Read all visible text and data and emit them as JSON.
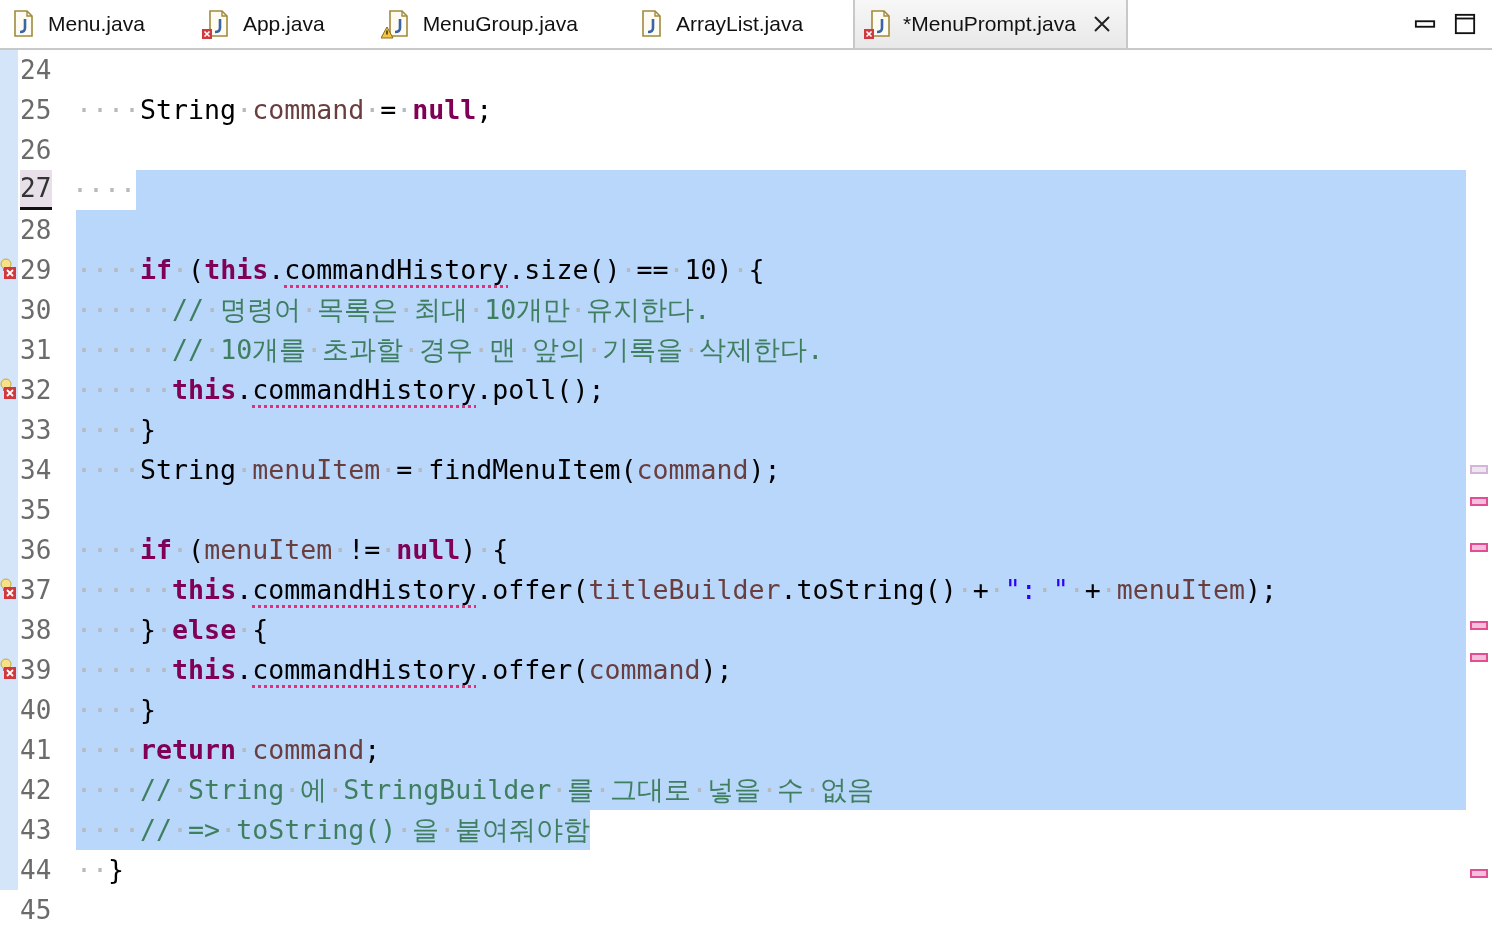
{
  "tabs": [
    {
      "label": "Menu.java",
      "error": false,
      "warning": false,
      "selected": false
    },
    {
      "label": "App.java",
      "error": true,
      "warning": false,
      "selected": false
    },
    {
      "label": "MenuGroup.java",
      "error": false,
      "warning": true,
      "selected": false
    },
    {
      "label": "ArrayList.java",
      "error": false,
      "warning": false,
      "selected": false
    },
    {
      "label": "*MenuPrompt.java",
      "error": true,
      "warning": false,
      "selected": true
    }
  ],
  "editor": {
    "lines": [
      {
        "number": "24",
        "current": false,
        "error": false,
        "selected": false
      },
      {
        "number": "25",
        "current": false,
        "error": false,
        "selected": false,
        "tokens": [
          {
            "kind": "ws",
            "text": "····"
          },
          {
            "kind": "plain",
            "text": "String"
          },
          {
            "kind": "ws",
            "text": "·"
          },
          {
            "kind": "local",
            "text": "command"
          },
          {
            "kind": "plain",
            "text": "·=·"
          },
          {
            "kind": "keyword",
            "text": "null"
          },
          {
            "kind": "plain",
            "text": ";"
          }
        ]
      },
      {
        "number": "26",
        "current": false,
        "error": false,
        "selected": false
      },
      {
        "number": "27",
        "current": true,
        "error": false,
        "selected": true,
        "tokens": [
          {
            "kind": "ws",
            "text": "····"
          }
        ]
      },
      {
        "number": "28",
        "current": false,
        "error": false,
        "selected": true
      },
      {
        "number": "29",
        "current": false,
        "error": true,
        "selected": true,
        "tokens": [
          {
            "kind": "ws",
            "text": "····"
          },
          {
            "kind": "keyword",
            "text": "if"
          },
          {
            "kind": "plain",
            "text": "·("
          },
          {
            "kind": "keyword",
            "text": "this"
          },
          {
            "kind": "plain",
            "text": "."
          },
          {
            "kind": "error",
            "text": "commandHistory"
          },
          {
            "kind": "plain",
            "text": ".size()·==·10)·{"
          }
        ]
      },
      {
        "number": "30",
        "current": false,
        "error": false,
        "selected": true,
        "tokens": [
          {
            "kind": "ws",
            "text": "······"
          },
          {
            "kind": "comment",
            "text": "//·명령어·목록은·최대·10개만·유지한다."
          }
        ]
      },
      {
        "number": "31",
        "current": false,
        "error": false,
        "selected": true,
        "tokens": [
          {
            "kind": "ws",
            "text": "······"
          },
          {
            "kind": "comment",
            "text": "//·10개를·초과할·경우·맨·앞의·기록을·삭제한다."
          }
        ]
      },
      {
        "number": "32",
        "current": false,
        "error": true,
        "selected": true,
        "tokens": [
          {
            "kind": "ws",
            "text": "······"
          },
          {
            "kind": "keyword",
            "text": "this"
          },
          {
            "kind": "plain",
            "text": "."
          },
          {
            "kind": "error",
            "text": "commandHistory"
          },
          {
            "kind": "plain",
            "text": ".poll();"
          }
        ]
      },
      {
        "number": "33",
        "current": false,
        "error": false,
        "selected": true,
        "tokens": [
          {
            "kind": "ws",
            "text": "····"
          },
          {
            "kind": "plain",
            "text": "}"
          }
        ]
      },
      {
        "number": "34",
        "current": false,
        "error": false,
        "selected": true,
        "tokens": [
          {
            "kind": "ws",
            "text": "····"
          },
          {
            "kind": "plain",
            "text": "String·"
          },
          {
            "kind": "local",
            "text": "menuItem"
          },
          {
            "kind": "plain",
            "text": "·=·findMenuItem("
          },
          {
            "kind": "local",
            "text": "command"
          },
          {
            "kind": "plain",
            "text": ");"
          }
        ]
      },
      {
        "number": "35",
        "current": false,
        "error": false,
        "selected": true
      },
      {
        "number": "36",
        "current": false,
        "error": false,
        "selected": true,
        "tokens": [
          {
            "kind": "ws",
            "text": "····"
          },
          {
            "kind": "keyword",
            "text": "if"
          },
          {
            "kind": "plain",
            "text": "·("
          },
          {
            "kind": "local",
            "text": "menuItem"
          },
          {
            "kind": "plain",
            "text": "·!=·"
          },
          {
            "kind": "keyword",
            "text": "null"
          },
          {
            "kind": "plain",
            "text": ")·{"
          }
        ]
      },
      {
        "number": "37",
        "current": false,
        "error": true,
        "selected": true,
        "tokens": [
          {
            "kind": "ws",
            "text": "······"
          },
          {
            "kind": "keyword",
            "text": "this"
          },
          {
            "kind": "plain",
            "text": "."
          },
          {
            "kind": "error",
            "text": "commandHistory"
          },
          {
            "kind": "plain",
            "text": ".offer("
          },
          {
            "kind": "local",
            "text": "titleBuilder"
          },
          {
            "kind": "plain",
            "text": ".toString()·+·"
          },
          {
            "kind": "string",
            "text": "\":·\""
          },
          {
            "kind": "plain",
            "text": "·+·"
          },
          {
            "kind": "local",
            "text": "menuItem"
          },
          {
            "kind": "plain",
            "text": ");"
          }
        ]
      },
      {
        "number": "38",
        "current": false,
        "error": false,
        "selected": true,
        "tokens": [
          {
            "kind": "ws",
            "text": "····"
          },
          {
            "kind": "plain",
            "text": "}·"
          },
          {
            "kind": "keyword",
            "text": "else"
          },
          {
            "kind": "plain",
            "text": "·{"
          }
        ]
      },
      {
        "number": "39",
        "current": false,
        "error": true,
        "selected": true,
        "tokens": [
          {
            "kind": "ws",
            "text": "······"
          },
          {
            "kind": "keyword",
            "text": "this"
          },
          {
            "kind": "plain",
            "text": "."
          },
          {
            "kind": "error",
            "text": "commandHistory"
          },
          {
            "kind": "plain",
            "text": ".offer("
          },
          {
            "kind": "local",
            "text": "command"
          },
          {
            "kind": "plain",
            "text": ");"
          }
        ]
      },
      {
        "number": "40",
        "current": false,
        "error": false,
        "selected": true,
        "tokens": [
          {
            "kind": "ws",
            "text": "····"
          },
          {
            "kind": "plain",
            "text": "}"
          }
        ]
      },
      {
        "number": "41",
        "current": false,
        "error": false,
        "selected": true,
        "tokens": [
          {
            "kind": "ws",
            "text": "····"
          },
          {
            "kind": "keyword",
            "text": "return"
          },
          {
            "kind": "plain",
            "text": "·"
          },
          {
            "kind": "local",
            "text": "command"
          },
          {
            "kind": "plain",
            "text": ";"
          }
        ]
      },
      {
        "number": "42",
        "current": false,
        "error": false,
        "selected": true,
        "tokens": [
          {
            "kind": "ws",
            "text": "····"
          },
          {
            "kind": "comment",
            "text": "//·String·에·StringBuilder·를·그대로·넣을·수·없음"
          }
        ]
      },
      {
        "number": "43",
        "current": false,
        "error": false,
        "selected": true,
        "tokens": [
          {
            "kind": "ws",
            "text": "····"
          },
          {
            "kind": "comment",
            "text": "//·=>·toString()·을·붙여줘야함"
          }
        ]
      },
      {
        "number": "44",
        "current": false,
        "error": false,
        "selected": false,
        "tokens": [
          {
            "kind": "ws",
            "text": "··"
          },
          {
            "kind": "plain",
            "text": "}"
          }
        ]
      },
      {
        "number": "45",
        "current": false,
        "error": false,
        "selected": false
      }
    ]
  },
  "overview_ruler": [
    {
      "kind": "occurrence"
    },
    {
      "kind": "error"
    },
    {
      "kind": "error"
    },
    {
      "kind": "error"
    },
    {
      "kind": "error"
    },
    {
      "kind": "error"
    }
  ]
}
